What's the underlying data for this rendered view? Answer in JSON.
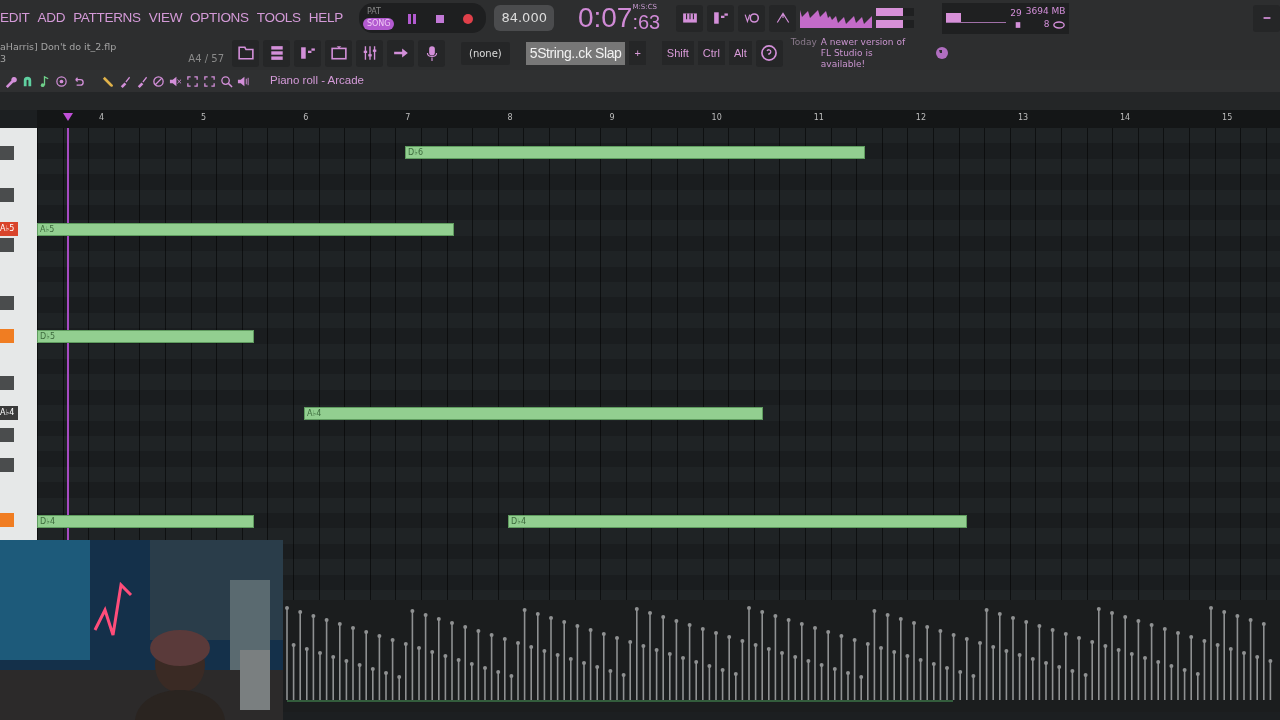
{
  "menu": [
    "EDIT",
    "ADD",
    "PATTERNS",
    "VIEW",
    "OPTIONS",
    "TOOLS",
    "HELP"
  ],
  "transport": {
    "modes": [
      {
        "label": "PAT",
        "selected": false
      },
      {
        "label": "SONG",
        "selected": true
      }
    ],
    "tempo": "84.000",
    "time_main": "0:07",
    "time_cs": ":63",
    "time_unit": "M:S:CS"
  },
  "meters": [
    {
      "level": 0.7
    },
    {
      "level": 0.7
    }
  ],
  "cpu": {
    "level": 0.25,
    "polyphony": "29",
    "memory": "3694 MB",
    "voices": "8"
  },
  "project": {
    "file": "aHarris] Don't do it_2.flp",
    "line_2": "3",
    "position": "A4 / 57"
  },
  "pattern": {
    "name": "(none)",
    "channel": "5String..ck Slap",
    "add": "+"
  },
  "modifiers": [
    "Shift",
    "Ctrl",
    "Alt"
  ],
  "hint": {
    "day": "Today",
    "message": "A newer version of FL Studio is available!"
  },
  "piano_roll": {
    "title": "Piano roll - Arcade",
    "bars": [
      "4",
      "5",
      "6",
      "7",
      "8",
      "9",
      "10",
      "11",
      "12",
      "13",
      "14",
      "15"
    ],
    "keys": [
      {
        "label": "A♭5",
        "color": "#d9442b"
      },
      {
        "label": "A♭4",
        "color": "#3a3a3a"
      }
    ],
    "notes": [
      {
        "label": "D♭6"
      },
      {
        "label": "A♭5"
      },
      {
        "label": "D♭5"
      },
      {
        "label": "A♭4"
      },
      {
        "label": "D♭4"
      },
      {
        "label": "D♭4"
      }
    ]
  }
}
